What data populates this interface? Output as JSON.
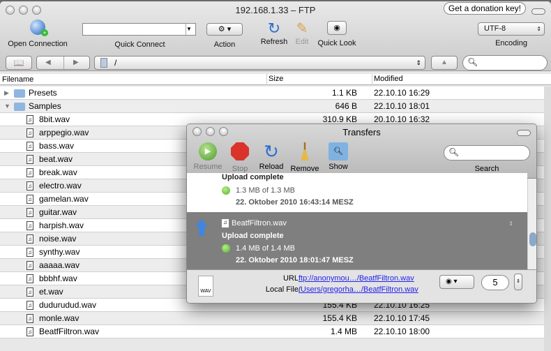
{
  "window": {
    "title": "192.168.1.33 – FTP",
    "donate": "Get a donation key!"
  },
  "toolbar": {
    "open_connection": "Open Connection",
    "quick_connect": "Quick Connect",
    "quick_connect_value": "",
    "action": "Action",
    "refresh": "Refresh",
    "edit": "Edit",
    "quick_look": "Quick Look",
    "encoding_value": "UTF-8",
    "encoding": "Encoding"
  },
  "path": {
    "value": "/"
  },
  "search": {
    "placeholder": ""
  },
  "columns": {
    "filename": "Filename",
    "size": "Size",
    "modified": "Modified"
  },
  "files": [
    {
      "name": "Presets",
      "size": "1.1 KB",
      "modified": "22.10.10 16:29",
      "type": "folder",
      "expanded": false
    },
    {
      "name": "Samples",
      "size": "646 B",
      "modified": "22.10.10 18:01",
      "type": "folder",
      "expanded": true
    },
    {
      "name": "8bit.wav",
      "size": "310.9 KB",
      "modified": "20.10.10 16:32"
    },
    {
      "name": "arppegio.wav",
      "size": "",
      "modified": ""
    },
    {
      "name": "bass.wav",
      "size": "",
      "modified": ""
    },
    {
      "name": "beat.wav",
      "size": "",
      "modified": ""
    },
    {
      "name": "break.wav",
      "size": "",
      "modified": ""
    },
    {
      "name": "electro.wav",
      "size": "",
      "modified": ""
    },
    {
      "name": "gamelan.wav",
      "size": "",
      "modified": ""
    },
    {
      "name": "guitar.wav",
      "size": "",
      "modified": ""
    },
    {
      "name": "harpish.wav",
      "size": "",
      "modified": ""
    },
    {
      "name": "noise.wav",
      "size": "",
      "modified": ""
    },
    {
      "name": "synthy.wav",
      "size": "",
      "modified": ""
    },
    {
      "name": "aaaaa.wav",
      "size": "",
      "modified": ""
    },
    {
      "name": "bbbhf.wav",
      "size": "",
      "modified": ""
    },
    {
      "name": "et.wav",
      "size": "",
      "modified": ""
    },
    {
      "name": "dudurudud.wav",
      "size": "155.4 KB",
      "modified": "22.10.10 16:25"
    },
    {
      "name": "monle.wav",
      "size": "155.4 KB",
      "modified": "22.10.10 17:45"
    },
    {
      "name": "BeatfFiltron.wav",
      "size": "1.4 MB",
      "modified": "22.10.10 18:00"
    }
  ],
  "transfers": {
    "title": "Transfers",
    "buttons": {
      "resume": "Resume",
      "stop": "Stop",
      "reload": "Reload",
      "remove": "Remove",
      "show": "Show",
      "search": "Search"
    },
    "items": [
      {
        "status": "Upload complete",
        "progress": "1.3 MB of 1.3 MB",
        "date": "22. Oktober 2010 16:43:14 MESZ"
      },
      {
        "file": "BeatfFiltron.wav",
        "status": "Upload complete",
        "progress": "1.4 MB of 1.4 MB",
        "date": "22. Oktober 2010 18:01:47 MESZ"
      }
    ],
    "url_label": "URL:",
    "url": "ftp://anonymou…/BeatfFiltron.wav",
    "local_label": "Local File:",
    "local": "/Users/gregorha…/BeatfFiltron.wav",
    "file_badge": "WAV",
    "connections": "5"
  }
}
